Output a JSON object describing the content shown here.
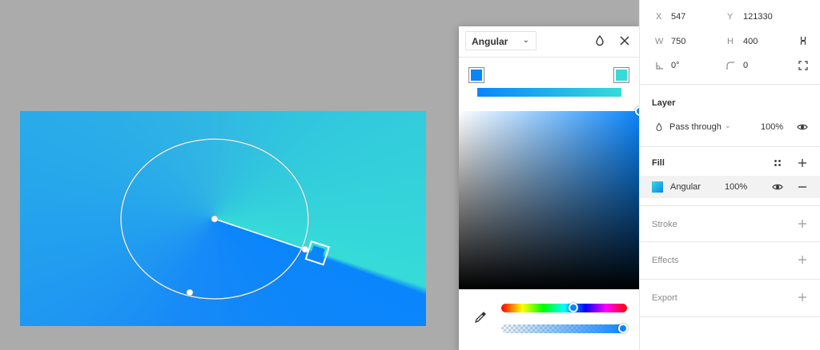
{
  "picker": {
    "type": "Angular",
    "stop_left_color": "#0a85fb",
    "stop_right_color": "#36dbd8",
    "hue_knob_color": "#0a85fb"
  },
  "transform": {
    "x_label": "X",
    "x_value": "547",
    "y_label": "Y",
    "y_value": "121330",
    "w_label": "W",
    "w_value": "750",
    "h_label": "H",
    "h_value": "400",
    "rotation": "0°",
    "radius": "0"
  },
  "layer": {
    "title": "Layer",
    "blend": "Pass through",
    "opacity": "100%"
  },
  "fill": {
    "title": "Fill",
    "type": "Angular",
    "opacity": "100%"
  },
  "stroke": {
    "title": "Stroke"
  },
  "effects": {
    "title": "Effects"
  },
  "export": {
    "title": "Export"
  }
}
